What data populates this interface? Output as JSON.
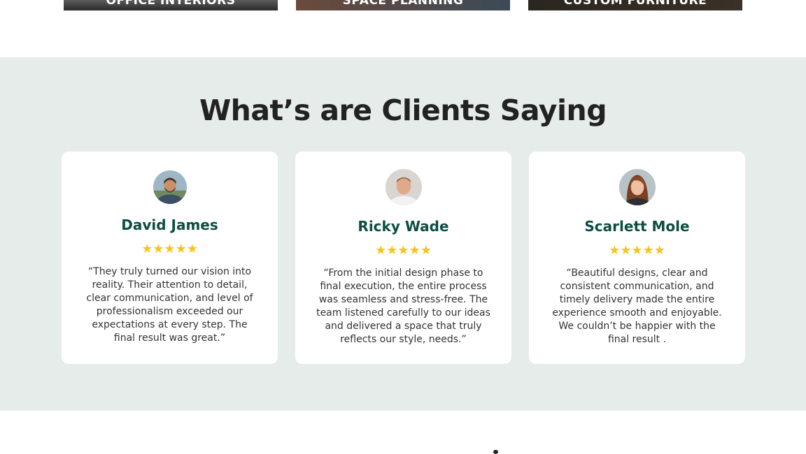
{
  "services": [
    {
      "label": "OFFICE INTERIORS"
    },
    {
      "label": "SPACE PLANNING"
    },
    {
      "label": "CUSTOM FURNITURE"
    }
  ],
  "testimonials": {
    "title": "What’s are Clients Saying",
    "rating_max": 5,
    "star_color": "#f5c518",
    "name_color": "#0d4d43",
    "background": "#e6ecea",
    "items": [
      {
        "name": "David James",
        "rating": 5,
        "stars": "★★★★★",
        "quote": "“They truly turned our vision into reality. Their attention to detail, clear communication, and level of professionalism exceeded our expectations at every step. The final result was great.”"
      },
      {
        "name": "Ricky Wade",
        "rating": 5,
        "stars": "★★★★★",
        "quote": "“From the initial design phase to final execution, the entire process was seamless and stress-free. The team listened carefully to our ideas and delivered a space that truly reflects our style, needs.”"
      },
      {
        "name": "Scarlett Mole",
        "rating": 5,
        "stars": "★★★★★",
        "quote": "“Beautiful designs, clear and consistent communication, and timely delivery made the entire experience smooth and enjoyable. We couldn’t be happier with the final result ."
      }
    ]
  }
}
